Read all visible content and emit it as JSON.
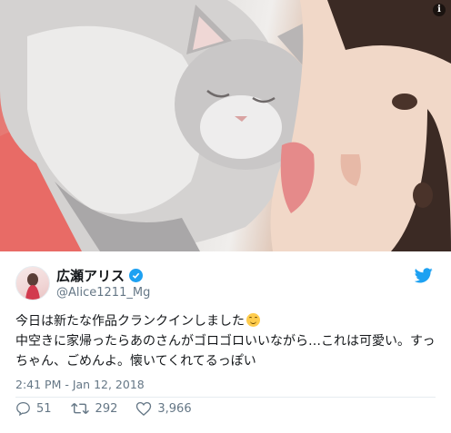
{
  "photo": {
    "info_icon_label": "i"
  },
  "tweet": {
    "display_name": "広瀬アリス",
    "handle": "@Alice1211_Mg",
    "text_line1": "今日は新たな作品クランクインしました",
    "text_line2": "中空きに家帰ったらあのさんがゴロゴロいいながら…これは可愛い。すっちゃん、ごめんよ。懐いてくれてるっぽい",
    "timestamp": "2:41 PM - Jan 12, 2018",
    "replies": "51",
    "retweets": "292",
    "likes": "3,966"
  },
  "colors": {
    "accent": "#1da1f2",
    "muted": "#657786",
    "text": "#14171a"
  },
  "icons": [
    "info-icon",
    "verified-badge-icon",
    "twitter-bird-icon",
    "reply-icon",
    "retweet-icon",
    "like-icon",
    "smile-emoji-icon"
  ]
}
